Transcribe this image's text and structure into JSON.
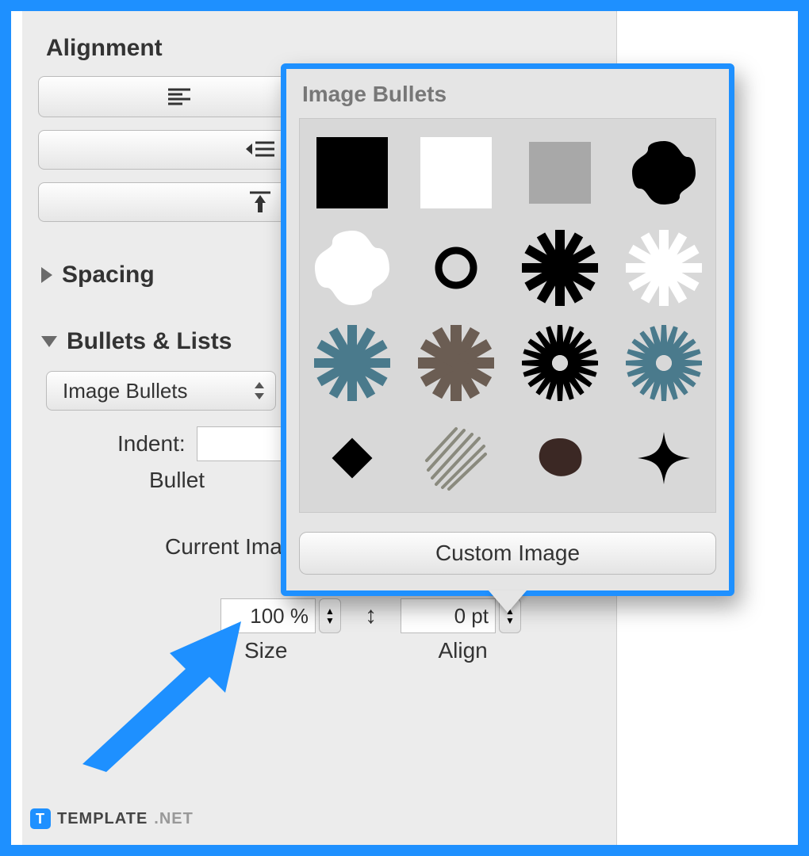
{
  "panel": {
    "alignment_title": "Alignment",
    "spacing_title": "Spacing",
    "bullets_title": "Bullets & Lists",
    "image_bullets_label": "Image Bullets",
    "indent_label": "Indent:",
    "bullet_label": "Bullet",
    "current_image_label": "Current Image:",
    "size_value": "100 %",
    "align_value": "0 pt",
    "size_label": "Size",
    "align_label": "Align"
  },
  "popover": {
    "title": "Image Bullets",
    "custom_button": "Custom Image",
    "bullets": [
      [
        "square-black",
        "square-white",
        "square-gray",
        "quatrefoil-black"
      ],
      [
        "quatrefoil-white",
        "circle-outline",
        "asterisk-black",
        "asterisk-white"
      ],
      [
        "asterisk-teal",
        "asterisk-brown",
        "sunburst-black",
        "sunburst-teal"
      ],
      [
        "diamond-black",
        "scribble-gray",
        "blob-brown",
        "sparkle-black"
      ]
    ]
  },
  "watermark": {
    "badge": "T",
    "text": "TEMPLATE",
    "tld": ".NET"
  },
  "colors": {
    "accent": "#1e90ff",
    "teal": "#4a7a8c",
    "brown": "#6b5d53",
    "gray": "#a8a8a8",
    "darkbrown": "#3b2824"
  }
}
